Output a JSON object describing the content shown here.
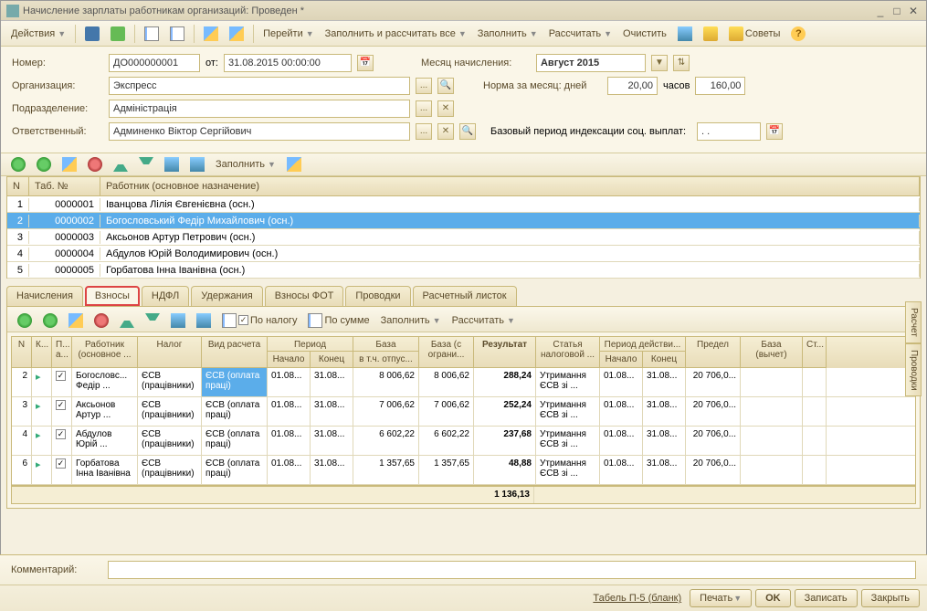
{
  "window": {
    "title": "Начисление зарплаты работникам организаций: Проведен *"
  },
  "toolbar": {
    "actions": "Действия",
    "goto": "Перейти",
    "fill_all": "Заполнить и рассчитать все",
    "fill": "Заполнить",
    "calc": "Рассчитать",
    "clear": "Очистить",
    "tips": "Советы"
  },
  "form": {
    "number_lbl": "Номер:",
    "number": "ДО000000001",
    "from_lbl": "от:",
    "date": "31.08.2015 00:00:00",
    "month_lbl": "Месяц начисления:",
    "month": "Август 2015",
    "org_lbl": "Организация:",
    "org": "Экспресс",
    "norm_lbl": "Норма за месяц: дней",
    "norm_days": "20,00",
    "hours_lbl": "часов",
    "norm_hours": "160,00",
    "dept_lbl": "Подразделение:",
    "dept": "Адмiнiстрацiя",
    "resp_lbl": "Ответственный:",
    "resp": "Админенко Вiктор Сергiйович",
    "base_lbl": "Базовый период индексации соц. выплат:",
    "base_val": ". ."
  },
  "minitb": {
    "fill": "Заполнить"
  },
  "employees": {
    "headers": {
      "n": "N",
      "tab": "Таб. №",
      "worker": "Работник (основное назначение)"
    },
    "rows": [
      {
        "n": "1",
        "tab": "0000001",
        "name": "Iванцова Лiлiя Євгенiєвна (осн.)"
      },
      {
        "n": "2",
        "tab": "0000002",
        "name": "Богословський Федiр Михайлович (осн.)"
      },
      {
        "n": "3",
        "tab": "0000003",
        "name": "Аксьонов Артур Петрович (осн.)"
      },
      {
        "n": "4",
        "tab": "0000004",
        "name": "Абдулов Юрiй Володимирович (осн.)"
      },
      {
        "n": "5",
        "tab": "0000005",
        "name": "Горбатова Iнна Iванiвна (осн.)"
      }
    ]
  },
  "tabs": {
    "t1": "Начисления",
    "t2": "Взносы",
    "t3": "НДФЛ",
    "t4": "Удержания",
    "t5": "Взносы ФОТ",
    "t6": "Проводки",
    "t7": "Расчетный листок"
  },
  "subtb": {
    "by_tax": "По налогу",
    "by_sum": "По сумме",
    "fill": "Заполнить",
    "calc": "Рассчитать"
  },
  "detail": {
    "h": {
      "n": "N",
      "k": "К...",
      "p": "П... а...",
      "worker": "Работник (основное ...",
      "tax": "Налог",
      "calc": "Вид расчета",
      "period": "Период",
      "start": "Начало",
      "end": "Конец",
      "base": "База",
      "base_vac": "в т.ч. отпус...",
      "base_lim": "База (с ограни...",
      "result": "Результат",
      "article": "Статья налоговой ...",
      "eff": "Период действи...",
      "eff_s": "Начало",
      "eff_e": "Конец",
      "limit": "Предел",
      "base_ded": "База (вычет)",
      "st": "Ст..."
    },
    "rows": [
      {
        "n": "2",
        "worker": "Богословс... Федiр ...",
        "tax": "ЄСВ (працiвники)",
        "calc": "ЄСВ (оплата працi)",
        "ps": "01.08...",
        "pe": "31.08...",
        "base": "8 006,62",
        "baselim": "8 006,62",
        "res": "288,24",
        "art": "Утримання ЄСВ зi ...",
        "es": "01.08...",
        "ee": "31.08...",
        "lim": "20 706,0..."
      },
      {
        "n": "3",
        "worker": "Аксьонов Артур ...",
        "tax": "ЄСВ (працiвники)",
        "calc": "ЄСВ (оплата працi)",
        "ps": "01.08...",
        "pe": "31.08...",
        "base": "7 006,62",
        "baselim": "7 006,62",
        "res": "252,24",
        "art": "Утримання ЄСВ зi ...",
        "es": "01.08...",
        "ee": "31.08...",
        "lim": "20 706,0..."
      },
      {
        "n": "4",
        "worker": "Абдулов Юрiй ...",
        "tax": "ЄСВ (працiвники)",
        "calc": "ЄСВ (оплата працi)",
        "ps": "01.08...",
        "pe": "31.08...",
        "base": "6 602,22",
        "baselim": "6 602,22",
        "res": "237,68",
        "art": "Утримання ЄСВ зi ...",
        "es": "01.08...",
        "ee": "31.08...",
        "lim": "20 706,0..."
      },
      {
        "n": "6",
        "worker": "Горбатова Iнна Iванiвна",
        "tax": "ЄСВ (працiвники)",
        "calc": "ЄСВ (оплата працi)",
        "ps": "01.08...",
        "pe": "31.08...",
        "base": "1 357,65",
        "baselim": "1 357,65",
        "res": "48,88",
        "art": "Утримання ЄСВ зi ...",
        "es": "01.08...",
        "ee": "31.08...",
        "lim": "20 706,0..."
      }
    ],
    "total": "1 136,13"
  },
  "sidebar": {
    "t1": "Расчет",
    "t2": "Проводки"
  },
  "footer": {
    "comment_lbl": "Комментарий:",
    "tabel": "Табель П-5 (бланк)",
    "print": "Печать",
    "ok": "OK",
    "save": "Записать",
    "close": "Закрыть"
  }
}
